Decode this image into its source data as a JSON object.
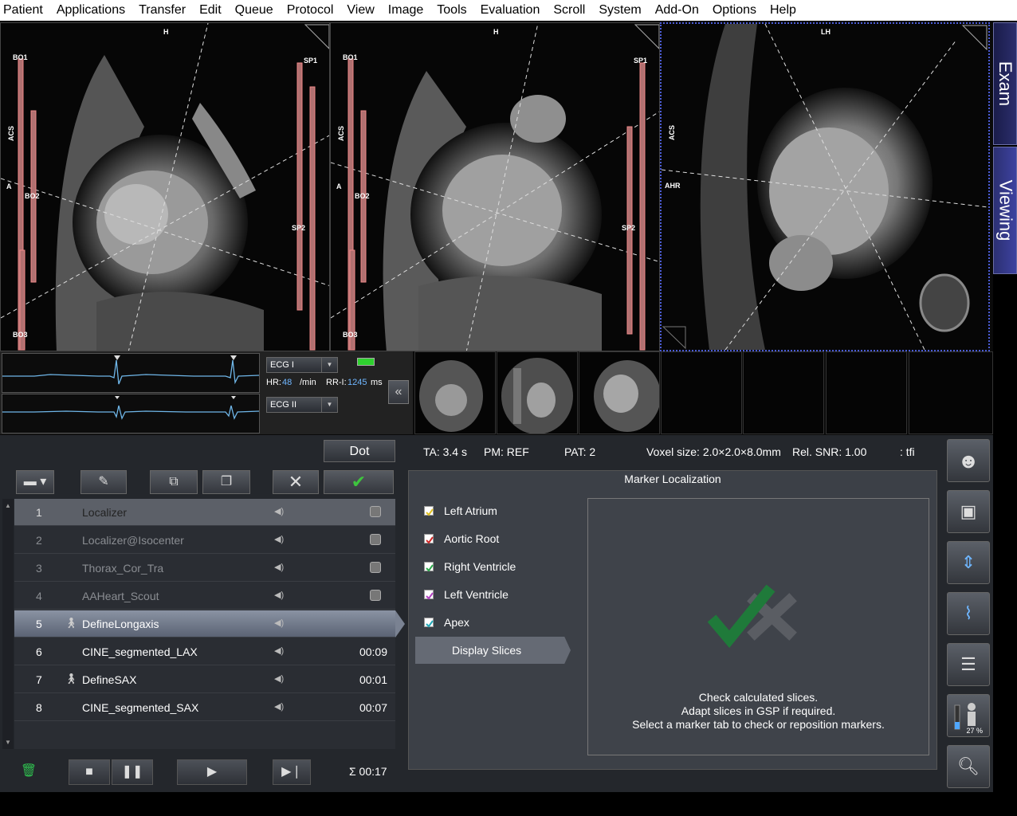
{
  "menu": [
    "Patient",
    "Applications",
    "Transfer",
    "Edit",
    "Queue",
    "Protocol",
    "View",
    "Image",
    "Tools",
    "Evaluation",
    "Scroll",
    "System",
    "Add-On",
    "Options",
    "Help"
  ],
  "side_tabs": {
    "exam": "Exam",
    "viewing": "Viewing"
  },
  "segments": {
    "seg1": {
      "top": "H",
      "left_upper": "ACS",
      "left_mid": "A",
      "bo1": "BO1",
      "bo2": "BO2",
      "bo3": "BO3",
      "sp1": "SP1",
      "sp2": "SP2"
    },
    "seg2": {
      "top": "H",
      "left_upper": "ACS",
      "left_mid": "A",
      "bo1": "BO1",
      "bo2": "BO2",
      "bo3": "BO3",
      "sp1": "SP1",
      "sp2": "SP2"
    },
    "seg3": {
      "top": "LH",
      "left_upper": "ACS",
      "left_mid": "AHR"
    }
  },
  "ecg": {
    "channel1": "ECG I",
    "channel2": "ECG II",
    "hr_label": "HR:",
    "hr_value": "48",
    "hr_unit": "/min",
    "rri_label": "RR-I:",
    "rri_value": "1245",
    "rri_unit": "ms",
    "collapse": "«"
  },
  "toolbar": {
    "dot": "Dot"
  },
  "queue": [
    {
      "num": "1",
      "name": "Localizer",
      "time": ""
    },
    {
      "num": "2",
      "name": "Localizer@Isocenter",
      "time": ""
    },
    {
      "num": "3",
      "name": "Thorax_Cor_Tra",
      "time": ""
    },
    {
      "num": "4",
      "name": "AAHeart_Scout",
      "time": ""
    },
    {
      "num": "5",
      "name": "DefineLongaxis",
      "time": ""
    },
    {
      "num": "6",
      "name": "CINE_segmented_LAX",
      "time": "00:09"
    },
    {
      "num": "7",
      "name": "DefineSAX",
      "time": "00:01"
    },
    {
      "num": "8",
      "name": "CINE_segmented_SAX",
      "time": "00:07"
    }
  ],
  "total_time": "Σ 00:17",
  "params": {
    "ta": "TA: 3.4 s",
    "pm": "PM: REF",
    "pat": "PAT: 2",
    "voxel": "Voxel size: 2.0×2.0×8.0mm",
    "snr": "Rel. SNR: 1.00",
    "seq": ": tfi"
  },
  "marker": {
    "title": "Marker Localization",
    "items": [
      {
        "label": "Left Atrium",
        "color": "#e0c020"
      },
      {
        "label": "Aortic Root",
        "color": "#d02828"
      },
      {
        "label": "Right Ventricle",
        "color": "#2aa84a"
      },
      {
        "label": "Left Ventricle",
        "color": "#b040c0"
      },
      {
        "label": "Apex",
        "color": "#20a8b8"
      }
    ],
    "display_slices": "Display Slices",
    "info": [
      "Check calculated slices.",
      "Adapt slices in GSP if required.",
      "Select a marker tab to check or reposition markers."
    ]
  },
  "right_tools": {
    "fill_percent": "27 %"
  }
}
